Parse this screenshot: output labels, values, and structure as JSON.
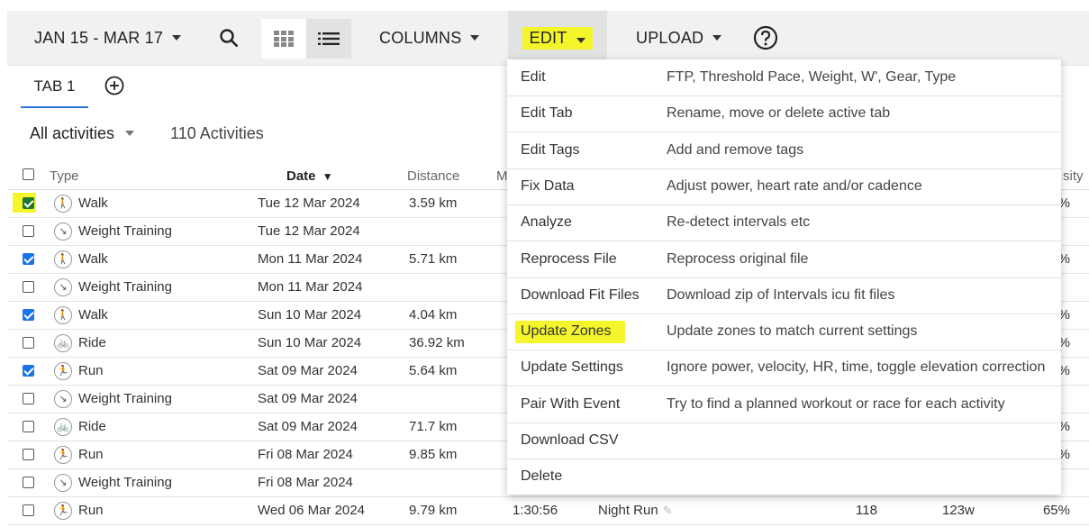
{
  "toolbar": {
    "date_range": "JAN 15 - MAR 17",
    "columns": "COLUMNS",
    "edit": "EDIT",
    "upload": "UPLOAD"
  },
  "tabs": {
    "tab1": "TAB 1"
  },
  "filter": {
    "selected": "All activities",
    "count": "110 Activities"
  },
  "table": {
    "headers": {
      "type": "Type",
      "date": "Date",
      "distance": "Distance",
      "moving_partial": "M",
      "intensity_partial": "sity"
    },
    "rows": [
      {
        "checked": true,
        "type": "Walk",
        "date": "Tue 12 Mar 2024",
        "distance": "3.59 km",
        "intensity": "%"
      },
      {
        "checked": false,
        "type": "Weight Training",
        "date": "Tue 12 Mar 2024",
        "distance": "",
        "intensity": ""
      },
      {
        "checked": true,
        "type": "Walk",
        "date": "Mon 11 Mar 2024",
        "distance": "5.71 km",
        "intensity": "%"
      },
      {
        "checked": false,
        "type": "Weight Training",
        "date": "Mon 11 Mar 2024",
        "distance": "",
        "intensity": ""
      },
      {
        "checked": true,
        "type": "Walk",
        "date": "Sun 10 Mar 2024",
        "distance": "4.04 km",
        "intensity": "%"
      },
      {
        "checked": false,
        "type": "Ride",
        "date": "Sun 10 Mar 2024",
        "distance": "36.92 km",
        "intensity": "%"
      },
      {
        "checked": true,
        "type": "Run",
        "date": "Sat 09 Mar 2024",
        "distance": "5.64 km",
        "intensity": "%"
      },
      {
        "checked": false,
        "type": "Weight Training",
        "date": "Sat 09 Mar 2024",
        "distance": "",
        "intensity": ""
      },
      {
        "checked": false,
        "type": "Ride",
        "date": "Sat 09 Mar 2024",
        "distance": "71.7 km",
        "intensity": "%"
      },
      {
        "checked": false,
        "type": "Run",
        "date": "Fri 08 Mar 2024",
        "distance": "9.85 km",
        "intensity": "%"
      },
      {
        "checked": false,
        "type": "Weight Training",
        "date": "Fri 08 Mar 2024",
        "distance": "",
        "intensity": ""
      },
      {
        "checked": false,
        "type": "Run",
        "date": "Wed 06 Mar 2024",
        "distance": "9.79 km",
        "intensity": "65%"
      }
    ],
    "last_row_extra": {
      "moving": "1:30:56",
      "name": "Night Run",
      "hr": "118",
      "power": "123w"
    }
  },
  "edit_menu": [
    {
      "label": "Edit",
      "desc": "FTP, Threshold Pace, Weight, W', Gear, Type"
    },
    {
      "label": "Edit Tab",
      "desc": "Rename, move or delete active tab"
    },
    {
      "label": "Edit Tags",
      "desc": "Add and remove tags"
    },
    {
      "label": "Fix Data",
      "desc": "Adjust power, heart rate and/or cadence"
    },
    {
      "label": "Analyze",
      "desc": "Re-detect intervals etc"
    },
    {
      "label": "Reprocess File",
      "desc": "Reprocess original file"
    },
    {
      "label": "Download Fit Files",
      "desc": "Download zip of Intervals icu fit files"
    },
    {
      "label": "Update Zones",
      "desc": "Update zones to match current settings"
    },
    {
      "label": "Update Settings",
      "desc": "Ignore power, velocity, HR, time, toggle elevation correction"
    },
    {
      "label": "Pair With Event",
      "desc": "Try to find a planned workout or race for each activity"
    },
    {
      "label": "Download CSV",
      "desc": ""
    },
    {
      "label": "Delete",
      "desc": ""
    }
  ],
  "colors": {
    "highlight": "#f5f52c",
    "checkbox_blue": "#1a73e8",
    "tab_underline": "#2b73d6"
  }
}
